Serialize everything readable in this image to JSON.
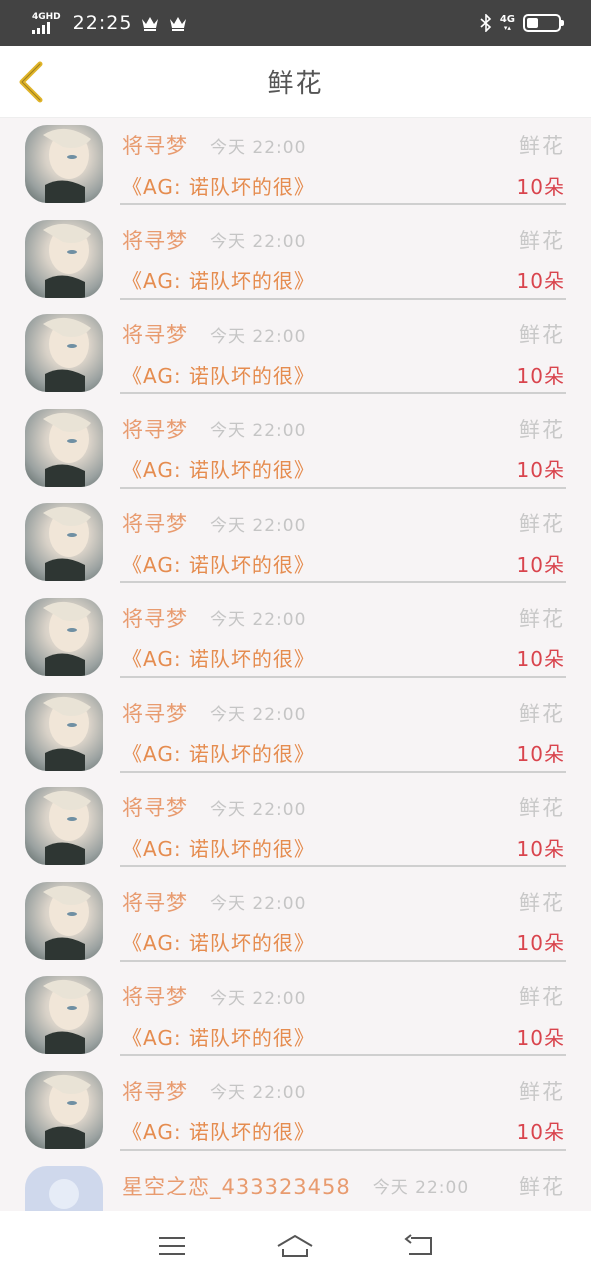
{
  "status_bar": {
    "network_label": "4GHD",
    "time": "22:25",
    "right_network_label": "4G"
  },
  "header": {
    "title": "鲜花"
  },
  "records": [
    {
      "username": "将寻梦",
      "time": "今天 22:00",
      "gift_type": "鲜花",
      "room": "《AG: 诺队坏的很》",
      "count": "10朵"
    },
    {
      "username": "将寻梦",
      "time": "今天 22:00",
      "gift_type": "鲜花",
      "room": "《AG: 诺队坏的很》",
      "count": "10朵"
    },
    {
      "username": "将寻梦",
      "time": "今天 22:00",
      "gift_type": "鲜花",
      "room": "《AG: 诺队坏的很》",
      "count": "10朵"
    },
    {
      "username": "将寻梦",
      "time": "今天 22:00",
      "gift_type": "鲜花",
      "room": "《AG: 诺队坏的很》",
      "count": "10朵"
    },
    {
      "username": "将寻梦",
      "time": "今天 22:00",
      "gift_type": "鲜花",
      "room": "《AG: 诺队坏的很》",
      "count": "10朵"
    },
    {
      "username": "将寻梦",
      "time": "今天 22:00",
      "gift_type": "鲜花",
      "room": "《AG: 诺队坏的很》",
      "count": "10朵"
    },
    {
      "username": "将寻梦",
      "time": "今天 22:00",
      "gift_type": "鲜花",
      "room": "《AG: 诺队坏的很》",
      "count": "10朵"
    },
    {
      "username": "将寻梦",
      "time": "今天 22:00",
      "gift_type": "鲜花",
      "room": "《AG: 诺队坏的很》",
      "count": "10朵"
    },
    {
      "username": "将寻梦",
      "time": "今天 22:00",
      "gift_type": "鲜花",
      "room": "《AG: 诺队坏的很》",
      "count": "10朵"
    },
    {
      "username": "将寻梦",
      "time": "今天 22:00",
      "gift_type": "鲜花",
      "room": "《AG: 诺队坏的很》",
      "count": "10朵"
    },
    {
      "username": "将寻梦",
      "time": "今天 22:00",
      "gift_type": "鲜花",
      "room": "《AG: 诺队坏的很》",
      "count": "10朵"
    },
    {
      "username": "星空之恋_433323458",
      "time": "今天 22:00",
      "gift_type": "鲜花",
      "room": "",
      "count": ""
    }
  ],
  "colors": {
    "username": "#e89b6f",
    "room": "#e58c4f",
    "count": "#d9444d",
    "back_arrow": "#e0b429",
    "status_bar_bg": "#434343"
  },
  "icons": {
    "back": "chevron-left-icon",
    "menu": "menu-icon",
    "home": "home-icon",
    "return": "return-icon"
  }
}
